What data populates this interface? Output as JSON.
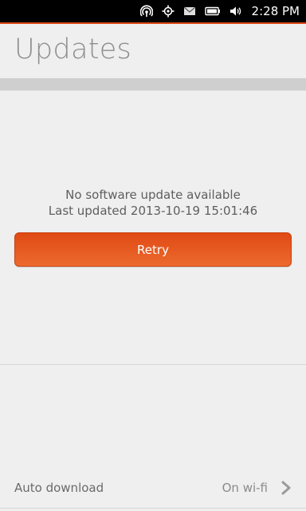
{
  "status_bar": {
    "icons": [
      "network-icon",
      "location-icon",
      "messages-icon",
      "battery-icon",
      "volume-icon"
    ],
    "time": "2:28 PM"
  },
  "header": {
    "title": "Updates"
  },
  "update_status": {
    "message": "No software update available",
    "last_updated": "Last updated 2013-10-19 15:01:46"
  },
  "retry_button": {
    "label": "Retry"
  },
  "auto_download": {
    "label": "Auto download",
    "value": "On wi-fi",
    "icon": "chevron-right-icon"
  },
  "colors": {
    "accent": "#dd4814",
    "background": "#efefef"
  }
}
